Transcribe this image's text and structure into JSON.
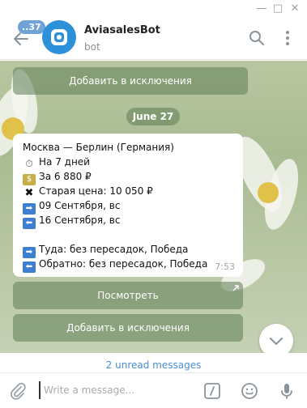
{
  "window": {
    "minimize": "—",
    "maximize": "□",
    "close": "✕"
  },
  "header": {
    "unread_badge": "..37",
    "bot_name": "AviasalesBot",
    "bot_status": "bot"
  },
  "chat": {
    "top_button": "Добавить в исключения",
    "date": "June 27",
    "message": {
      "lines": [
        {
          "icon": "",
          "text": "Москва — Берлин (Германия)"
        },
        {
          "icon": "timer-icon",
          "text": "На 7 дней"
        },
        {
          "icon": "money-icon",
          "text": "За 6 880 ₽"
        },
        {
          "icon": "cross-icon",
          "text": "Старая цена: 10 050 ₽"
        },
        {
          "icon": "right-arrow-icon",
          "text": "09 Сентября, вс"
        },
        {
          "icon": "left-arrow-icon",
          "text": "16 Сентября, вс"
        },
        {
          "icon": "",
          "text": ""
        },
        {
          "icon": "right-arrow-icon",
          "text": "Туда: без пересадок, Победа"
        },
        {
          "icon": "left-arrow-icon",
          "text": "Обратно: без пересадок, Победа"
        }
      ],
      "time": "7:53"
    },
    "buttons": {
      "view": "Посмотреть",
      "exclude": "Добавить в исключения"
    },
    "unread_messages": "2 unread messages"
  },
  "composer": {
    "placeholder": "Write a message..."
  },
  "colors": {
    "accent": "#2c91d8",
    "badge": "#6fa3d8",
    "link": "#4a8ed0"
  }
}
